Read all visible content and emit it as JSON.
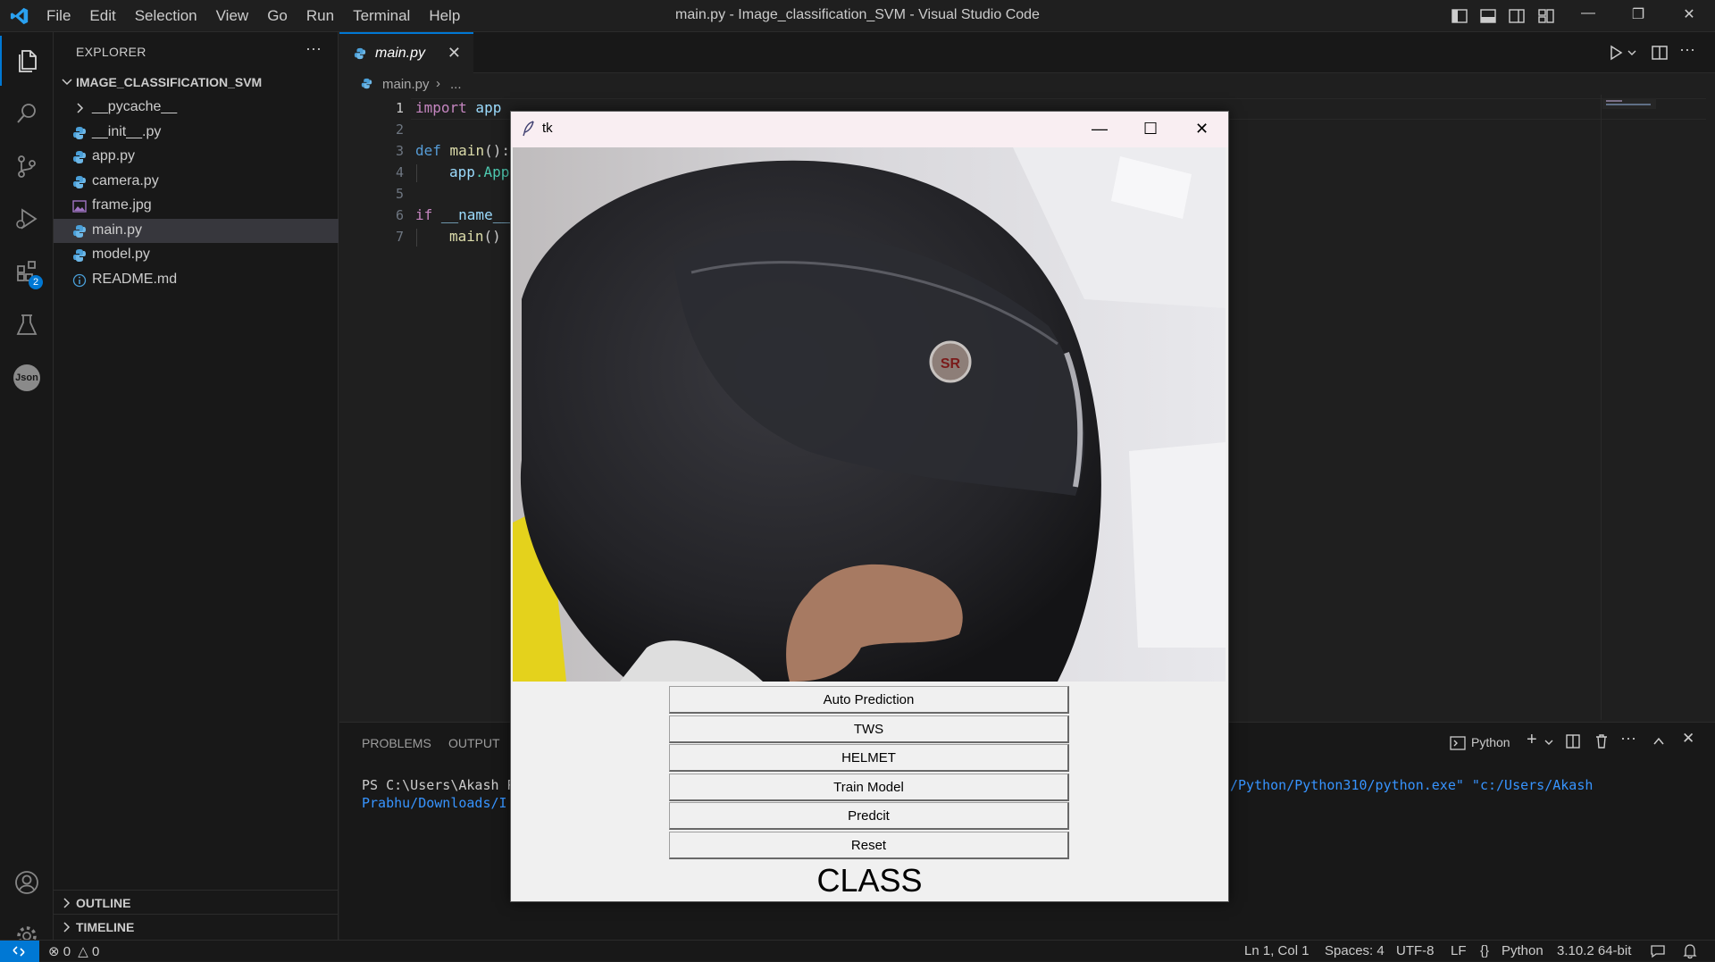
{
  "window": {
    "title": "main.py - Image_classification_SVM - Visual Studio Code",
    "menu": [
      "File",
      "Edit",
      "Selection",
      "View",
      "Go",
      "Run",
      "Terminal",
      "Help"
    ]
  },
  "activity_bar": {
    "extensions_badge": "2",
    "json_label": "Json"
  },
  "explorer": {
    "header": "EXPLORER",
    "root": "IMAGE_CLASSIFICATION_SVM",
    "items": [
      {
        "label": "__pycache__",
        "kind": "folder"
      },
      {
        "label": "__init__.py",
        "kind": "python"
      },
      {
        "label": "app.py",
        "kind": "python"
      },
      {
        "label": "camera.py",
        "kind": "python"
      },
      {
        "label": "frame.jpg",
        "kind": "image"
      },
      {
        "label": "main.py",
        "kind": "python",
        "active": true
      },
      {
        "label": "model.py",
        "kind": "python"
      },
      {
        "label": "README.md",
        "kind": "info"
      }
    ],
    "outline": "OUTLINE",
    "timeline": "TIMELINE"
  },
  "editor": {
    "tab_label": "main.py",
    "breadcrumb_file": "main.py",
    "breadcrumb_rest": "...",
    "line_numbers": [
      "1",
      "2",
      "3",
      "4",
      "5",
      "6",
      "7"
    ],
    "code": {
      "l1_kw": "import",
      "l1_mod": " app",
      "l3_kw": "def",
      "l3_fn": " main",
      "l3_rest": "():",
      "l4_obj": "app",
      "l4_rest": ".App",
      "l6_kw": "if",
      "l6_rest": " __name__",
      "l7_fn": "main",
      "l7_rest": "()"
    }
  },
  "panel": {
    "tabs": [
      "PROBLEMS",
      "OUTPUT"
    ],
    "terminal_kind": "Python",
    "prompt_line": "PS C:\\Users\\Akash P",
    "cmd_line_2": "Prabhu/Downloads/I",
    "cmd_right": "/Python/Python310/python.exe\" \"c:/Users/Akash"
  },
  "statusbar": {
    "errors": "0",
    "warnings": "0",
    "position": "Ln 1, Col 1",
    "spaces": "Spaces: 4",
    "encoding": "UTF-8",
    "eol": "LF",
    "language": "Python",
    "interpreter": "3.10.2 64-bit"
  },
  "tk_window": {
    "title": "tk",
    "buttons": [
      "Auto Prediction",
      "TWS",
      "HELMET",
      "Train Model",
      "Predcit",
      "Reset"
    ],
    "class_label": "CLASS",
    "helmet_logo": "SR"
  }
}
